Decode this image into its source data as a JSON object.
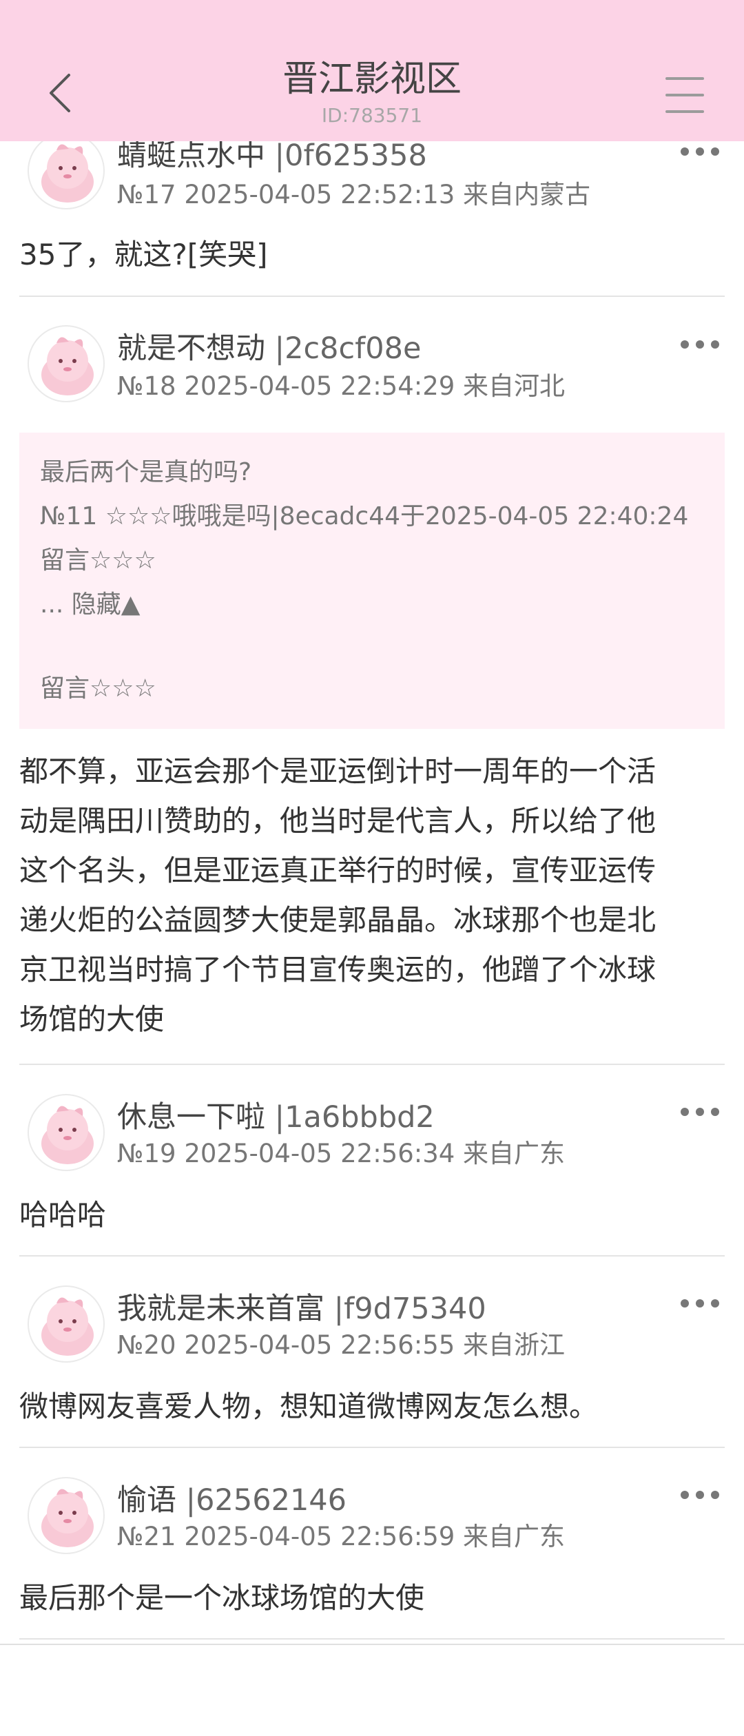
{
  "header": {
    "title": "晋江影视区",
    "id": "ID:783571",
    "background": "#fcd3e6"
  },
  "icons": {
    "back": "chevron-left-icon",
    "menu": "hamburger-menu-icon",
    "more": "more-dots-icon",
    "avatar": "pink-pig-mascot-avatar"
  },
  "posts": [
    {
      "username": "蜻蜓点水中",
      "uid": "|0f625358",
      "meta": "№17 2025-04-05 22:52:13 来自内蒙古",
      "content": "35了，就这?[笑哭]"
    },
    {
      "username": "就是不想动",
      "uid": "|2c8cf08e",
      "meta": "№18 2025-04-05 22:54:29 来自河北",
      "quote": {
        "line1": "最后两个是真的吗?",
        "line2": "№11 ☆☆☆哦哦是吗|8ecadc44于2025-04-05 22:40:24",
        "line3": "留言☆☆☆",
        "line4": "... 隐藏▲",
        "line5": "留言☆☆☆"
      },
      "content_lines": [
        "都不算，亚运会那个是亚运倒计时一周年的一个活",
        "动是隅田川赞助的，他当时是代言人，所以给了他",
        "这个名头，但是亚运真正举行的时候，宣传亚运传",
        "递火炬的公益圆梦大使是郭晶晶。冰球那个也是北",
        "京卫视当时搞了个节目宣传奥运的，他蹭了个冰球",
        "场馆的大使"
      ]
    },
    {
      "username": "休息一下啦",
      "uid": "|1a6bbbd2",
      "meta": "№19 2025-04-05 22:56:34 来自广东",
      "content": "哈哈哈"
    },
    {
      "username": "我就是未来首富",
      "uid": "|f9d75340",
      "meta": "№20 2025-04-05 22:56:55 来自浙江",
      "content": "微博网友喜爱人物，想知道微博网友怎么想。"
    },
    {
      "username": "愉语",
      "uid": "|62562146",
      "meta": "№21 2025-04-05 22:56:59 来自广东",
      "content": "最后那个是一个冰球场馆的大使"
    }
  ]
}
